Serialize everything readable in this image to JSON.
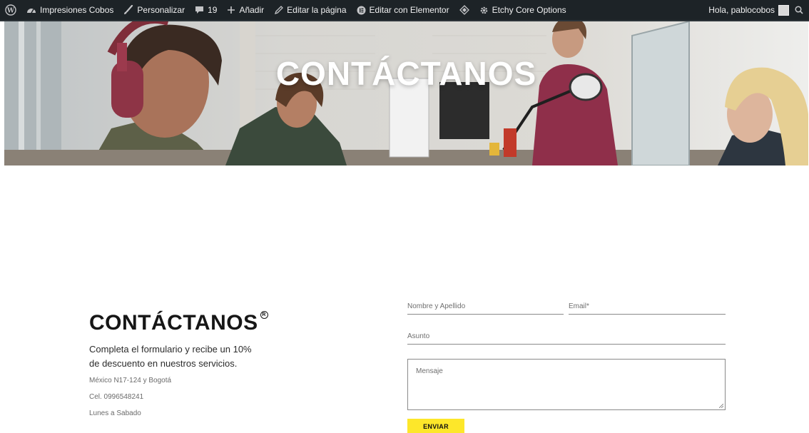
{
  "adminbar": {
    "site_name": "Impresiones Cobos",
    "customize": "Personalizar",
    "comments_count": "19",
    "add_new": "Añadir",
    "edit_page": "Editar la página",
    "edit_elementor": "Editar con Elementor",
    "etchy_options": "Etchy Core Options",
    "greeting": "Hola, pablocobos"
  },
  "hero": {
    "title": "CONTÁCTANOS"
  },
  "contact": {
    "title": "CONTÁCTANOS",
    "registered_mark": "R",
    "lead": "Completa el formulario y recibe un 10% de descuento en nuestros servicios.",
    "address": "México N17-124 y Bogotá",
    "phone": "Cel. 0996548241",
    "hours": "Lunes a Sabado"
  },
  "form": {
    "name_placeholder": "Nombre y Apellido",
    "email_placeholder": "Email*",
    "subject_placeholder": "Asunto",
    "message_placeholder": "Mensaje",
    "submit_label": "ENVIAR"
  },
  "colors": {
    "admin_bar": "#1d2327",
    "submit_button": "#fde72a"
  }
}
